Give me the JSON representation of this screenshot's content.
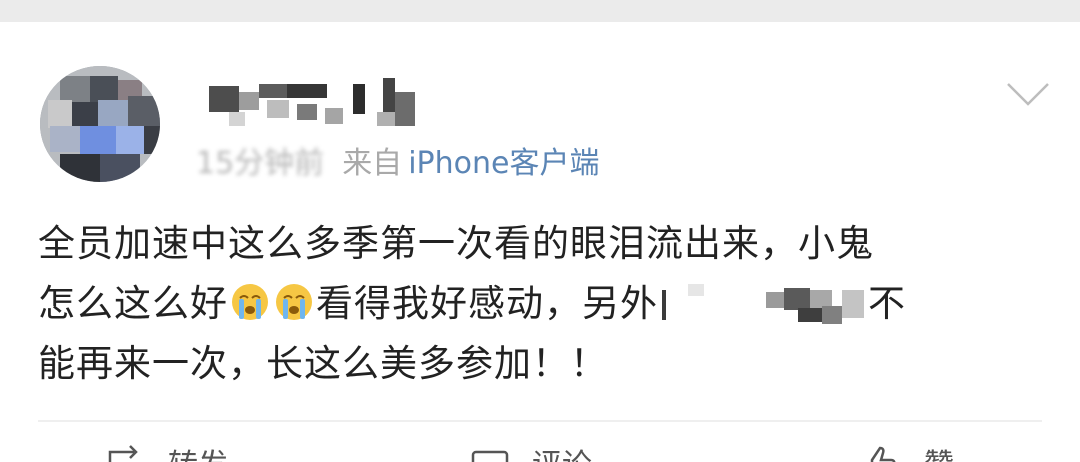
{
  "post": {
    "time_text": "15分钟前",
    "from_label": "来自",
    "source": "iPhone客户端",
    "content": {
      "line1": "全员加速中这么多季第一次看的眼泪流出来，小鬼",
      "line2_a": "怎么这么好",
      "line2_b": "看得我好感动，另外",
      "line2_c": "不",
      "line3": "能再来一次，长这么美多参加！！"
    },
    "emojis": [
      "crying-face",
      "crying-face"
    ]
  },
  "actions": {
    "repost_label": "转发",
    "comment_label": "评论",
    "like_label": "赞"
  },
  "icons": {
    "menu": "chevron-down-icon",
    "repost": "repost-icon",
    "comment": "comment-icon",
    "like": "thumbs-up-icon"
  },
  "colors": {
    "source_link": "#5b85b5",
    "meta_gray": "#a9a9a9",
    "text": "#222222"
  }
}
